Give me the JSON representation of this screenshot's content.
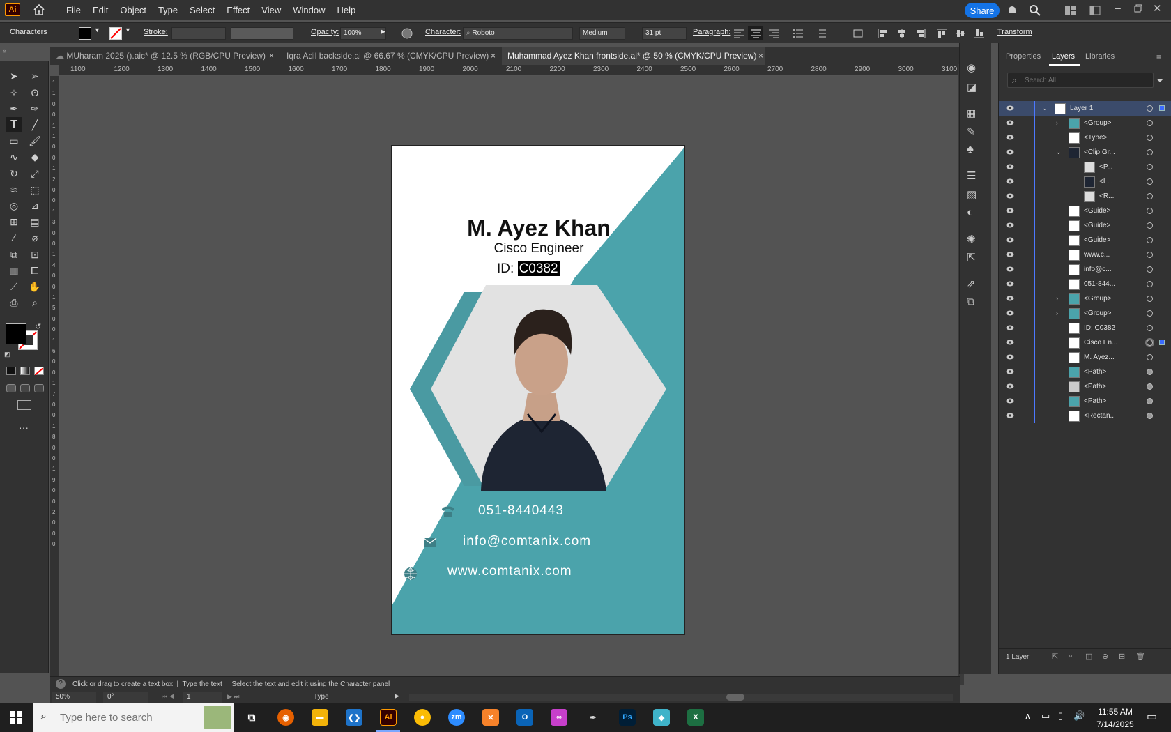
{
  "app": {
    "logo": "Ai",
    "share_label": "Share"
  },
  "menu": [
    "File",
    "Edit",
    "Object",
    "Type",
    "Select",
    "Effect",
    "View",
    "Window",
    "Help"
  ],
  "control": {
    "panel_label": "Characters",
    "stroke_label": "Stroke:",
    "opacity_label": "Opacity:",
    "opacity_value": "100%",
    "character_label": "Character:",
    "font": "Roboto",
    "weight": "Medium",
    "size": "31 pt",
    "paragraph_label": "Paragraph:",
    "transform_label": "Transform"
  },
  "tabs": [
    {
      "label": "MUharam 2025 ().aic* @ 12.5 % (RGB/CPU Preview)",
      "close": "×"
    },
    {
      "label": "Iqra Adil backside.ai @ 66.67 % (CMYK/CPU Preview)",
      "close": "×"
    },
    {
      "label": "Muhammad Ayez Khan frontside.ai* @ 50 % (CMYK/CPU Preview)",
      "close": "×"
    }
  ],
  "ruler": {
    "h": [
      "1100",
      "1200",
      "1300",
      "1400",
      "1500",
      "1600",
      "1700",
      "1800",
      "1900",
      "2000",
      "2100",
      "2200",
      "2300",
      "2400",
      "2500",
      "2600",
      "2700",
      "2800",
      "2900",
      "3000",
      "3100"
    ],
    "v": [
      "1",
      "1",
      "0",
      "0",
      "1",
      "1",
      "0",
      "0",
      "1",
      "2",
      "0",
      "0",
      "1",
      "3",
      "0",
      "0",
      "1",
      "4",
      "0",
      "0",
      "1",
      "5",
      "0",
      "0",
      "1",
      "6",
      "0",
      "0",
      "1",
      "7",
      "0",
      "0",
      "1",
      "8",
      "0",
      "0",
      "1",
      "9",
      "0",
      "0",
      "2",
      "0",
      "0",
      "0"
    ]
  },
  "card": {
    "name": "M. Ayez Khan",
    "title": "Cisco Engineer",
    "id_prefix": "ID: ",
    "id_value": "C0382",
    "phone": "051-8440443",
    "email": "info@comtanix.com",
    "web": "www.comtanix.com",
    "accent": "#4ba3ab",
    "accent_dark": "#3d8c93"
  },
  "panel": {
    "tabs": [
      "Properties",
      "Layers",
      "Libraries"
    ],
    "search_placeholder": "Search All",
    "layers": [
      {
        "name": "Layer 1",
        "indent": 0
      },
      {
        "name": "<Group>",
        "indent": 2
      },
      {
        "name": "<Type>",
        "indent": 2
      },
      {
        "name": "<Clip Gr...",
        "indent": 2
      },
      {
        "name": "<P...",
        "indent": 3
      },
      {
        "name": "<L...",
        "indent": 3
      },
      {
        "name": "<R...",
        "indent": 3
      },
      {
        "name": "<Guide>",
        "indent": 2
      },
      {
        "name": "<Guide>",
        "indent": 2
      },
      {
        "name": "<Guide>",
        "indent": 2
      },
      {
        "name": "www.c...",
        "indent": 2
      },
      {
        "name": "info@c...",
        "indent": 2
      },
      {
        "name": "051-844...",
        "indent": 2
      },
      {
        "name": "<Group>",
        "indent": 2
      },
      {
        "name": "<Group>",
        "indent": 2
      },
      {
        "name": "ID: C0382",
        "indent": 2
      },
      {
        "name": "Cisco En...",
        "indent": 2
      },
      {
        "name": "M. Ayez...",
        "indent": 2
      },
      {
        "name": "<Path>",
        "indent": 2
      },
      {
        "name": "<Path>",
        "indent": 2
      },
      {
        "name": "<Path>",
        "indent": 2
      },
      {
        "name": "<Rectan...",
        "indent": 2
      }
    ],
    "footer": "1 Layer"
  },
  "status": {
    "hint": "Click or drag to create a text box  |  Type the text  |  Select the text and edit it using the Character panel",
    "zoom": "50%",
    "rotation": "0°",
    "artboard": "1",
    "tool": "Type"
  },
  "taskbar": {
    "search_placeholder": "Type here to search",
    "time": "11:55 AM",
    "date": "7/14/2025"
  }
}
